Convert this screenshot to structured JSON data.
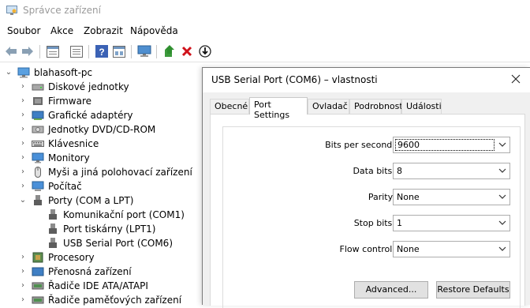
{
  "window": {
    "title": "Správce zařízení"
  },
  "menu": [
    "Soubor",
    "Akce",
    "Zobrazit",
    "Nápověda"
  ],
  "toolbar": [
    "back-icon",
    "forward-icon",
    "properties-icon",
    "update-icon",
    "help-icon",
    "view-icon",
    "monitor-icon",
    "update-driver-icon",
    "uninstall-icon",
    "scan-icon"
  ],
  "tree": {
    "root": "blahasoft-pc",
    "items": [
      "Diskové jednotky",
      "Firmware",
      "Grafické adaptéry",
      "Jednotky DVD/CD-ROM",
      "Klávesnice",
      "Monitory",
      "Myši a jiná polohovací zařízení",
      "Počítač",
      "Porty (COM a LPT)",
      "Komunikační port (COM1)",
      "Port tiskárny (LPT1)",
      "USB Serial Port (COM6)",
      "Procesory",
      "Přenosná zařízení",
      "Řadiče IDE ATA/ATAPI",
      "Řadiče paměťových zařízení"
    ]
  },
  "dialog": {
    "title": "USB Serial Port (COM6)  – vlastnosti",
    "tabs": [
      "Obecné",
      "Port Settings",
      "Ovladač",
      "Podrobnosti",
      "Události"
    ],
    "active_tab": "Port Settings",
    "fields": [
      {
        "label": "Bits per second:",
        "value": "9600"
      },
      {
        "label": "Data bits:",
        "value": "8"
      },
      {
        "label": "Parity:",
        "value": "None"
      },
      {
        "label": "Stop bits:",
        "value": "1"
      },
      {
        "label": "Flow control:",
        "value": "None"
      }
    ],
    "buttons": {
      "advanced": "Advanced...",
      "restore": "Restore Defaults"
    }
  }
}
